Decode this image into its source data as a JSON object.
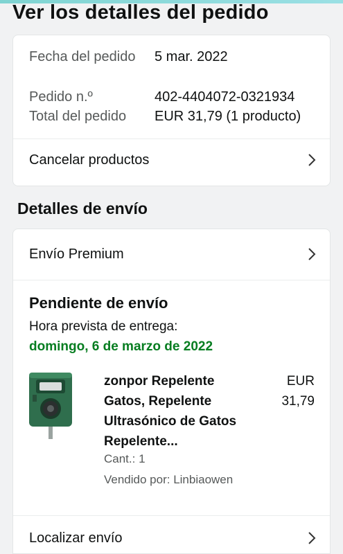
{
  "page": {
    "title": "Ver los detalles del pedido"
  },
  "summary": {
    "order_date_label": "Fecha del pedido",
    "order_date_value": "5 mar. 2022",
    "order_number_label": "Pedido n.º",
    "order_number_value": "402-4404072-0321934",
    "order_total_label": "Total del pedido",
    "order_total_value": "EUR 31,79 (1 producto)",
    "cancel_label": "Cancelar productos"
  },
  "shipping": {
    "section_title": "Detalles de envío",
    "premium_label": "Envío Premium",
    "status_title": "Pendiente de envío",
    "eta_label": "Hora prevista de entrega:",
    "eta_date": "domingo, 6 de marzo de 2022",
    "track_label": "Localizar envío",
    "accent_color": "#067d20"
  },
  "product": {
    "name": "zonpor Repelente Gatos, Repelente Ultrasónico de Gatos Repelente...",
    "price_currency": "EUR",
    "price_amount": "31,79",
    "quantity": "Cant.: 1",
    "seller": "Vendido por: Linbiaowen",
    "image_icon": "repellent-device-icon"
  },
  "icons": {
    "chevron": "chevron-right-icon"
  }
}
